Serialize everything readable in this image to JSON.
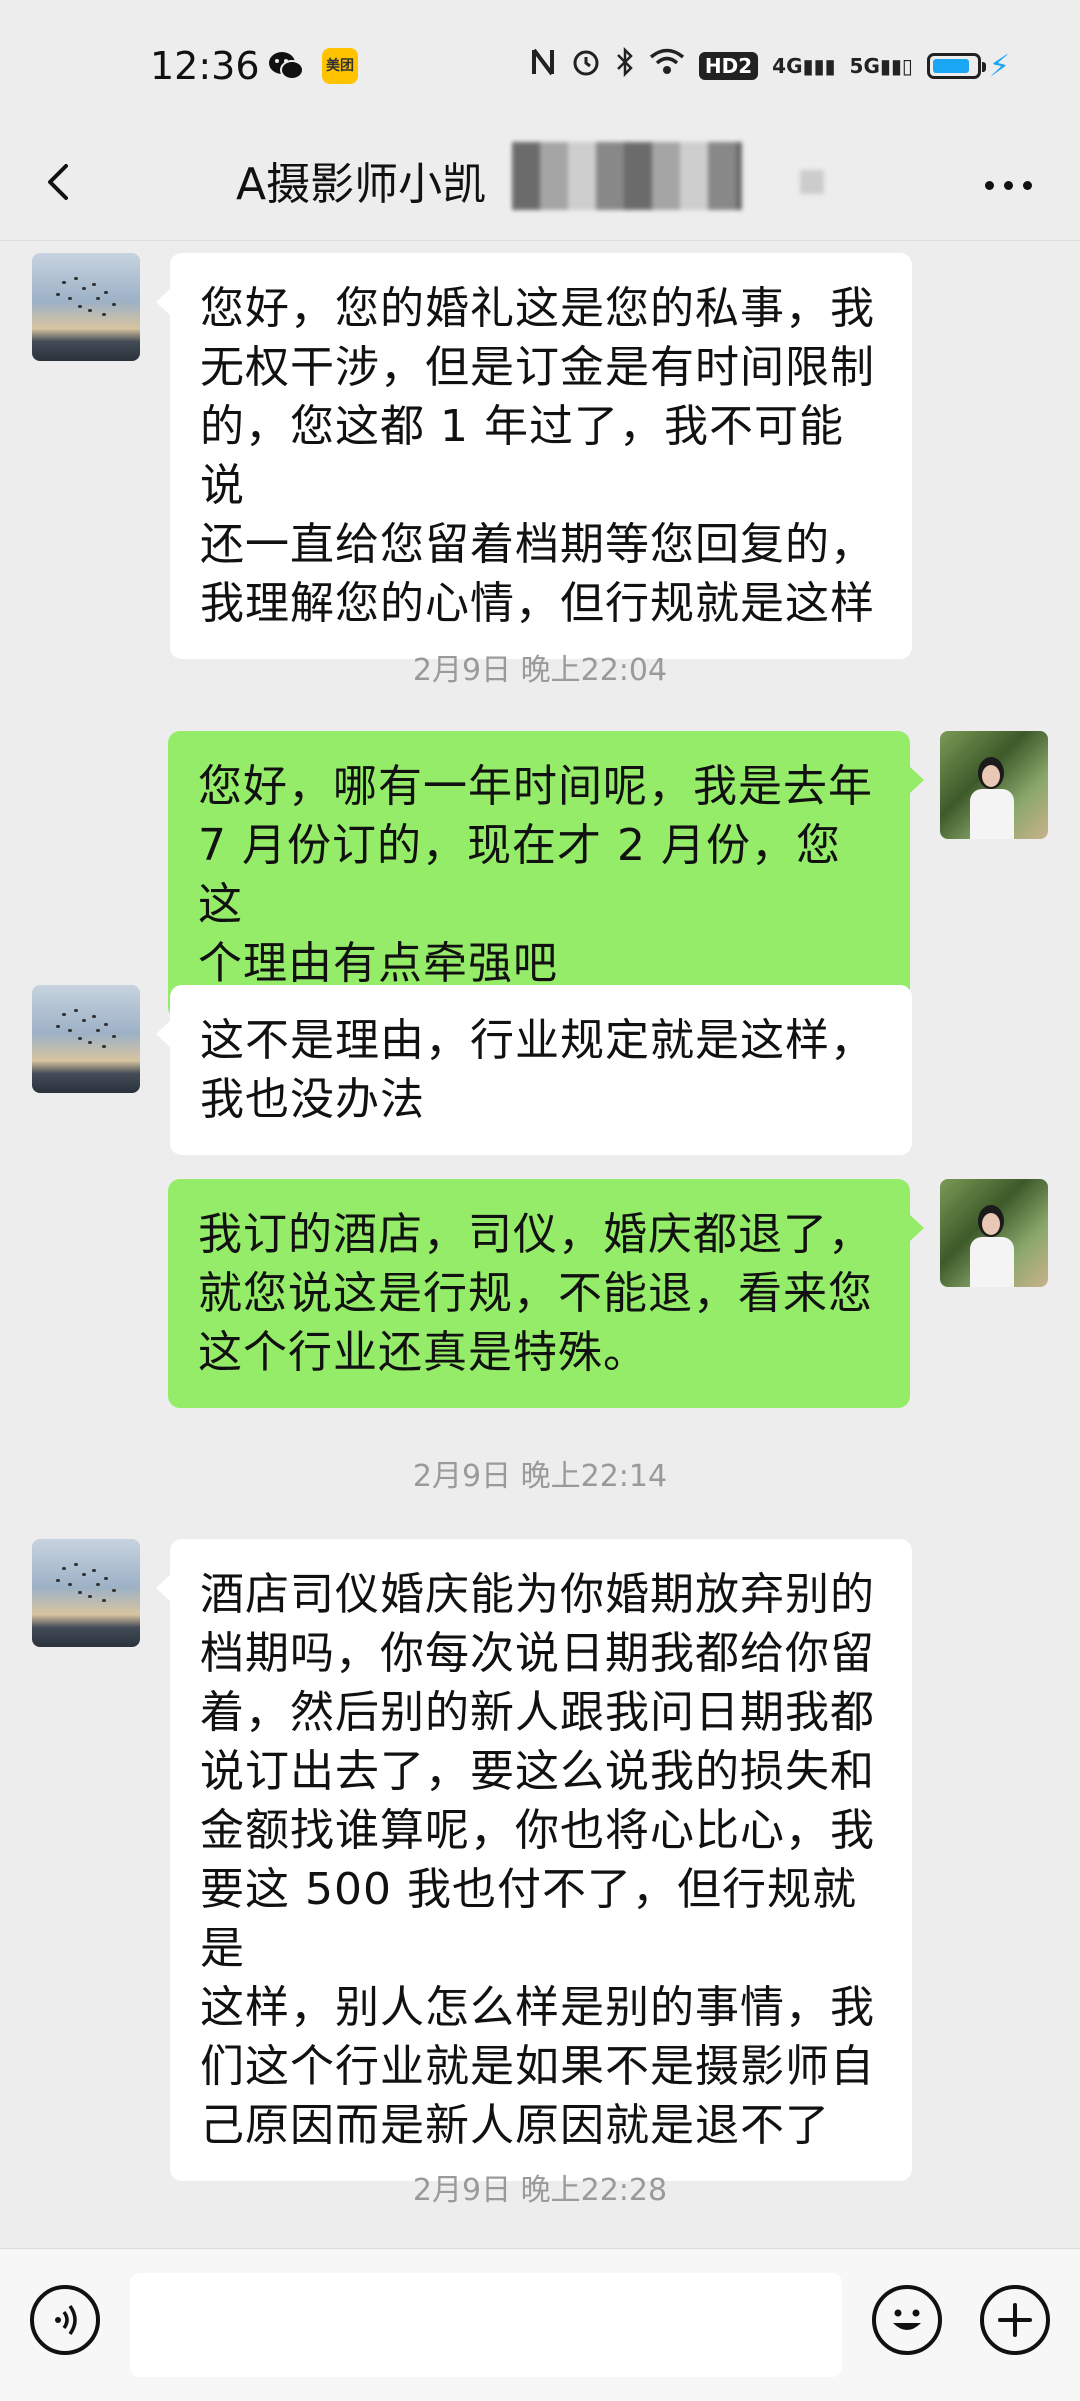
{
  "status_bar": {
    "time": "12:36",
    "icons": [
      "wechat-icon",
      "meituan-icon",
      "nfc-icon",
      "alarm-icon",
      "bluetooth-icon",
      "wifi-icon",
      "hd-icon",
      "signal-4g-icon",
      "signal-5g-icon",
      "battery-icon",
      "charging-icon"
    ],
    "meituan_label": "美团",
    "hd_label": "HD2",
    "net1": "4G",
    "net2": "5G",
    "battery_level": 0.85,
    "battery_color": "#1aa6f5"
  },
  "header": {
    "title": "A摄影师小凯",
    "back_icon": "chevron-left-icon",
    "more_icon": "more-dots-icon"
  },
  "messages": [
    {
      "side": "left",
      "text": "您好，您的婚礼这是您的私事，我\n无权干涉，但是订金是有时间限制\n的，您这都 1 年过了，我不可能说\n还一直给您留着档期等您回复的，\n我理解您的心情，但行规就是这样"
    },
    {
      "type": "time",
      "text": "2月9日 晚上22:04"
    },
    {
      "side": "right",
      "text": "您好，哪有一年时间呢，我是去年\n7 月份订的，现在才 2 月份，您这\n个理由有点牵强吧"
    },
    {
      "side": "left",
      "text": "这不是理由，行业规定就是这样，\n我也没办法"
    },
    {
      "side": "right",
      "text": "我订的酒店，司仪，婚庆都退了，\n就您说这是行规，不能退，看来您\n这个行业还真是特殊。"
    },
    {
      "type": "time",
      "text": "2月9日 晚上22:14"
    },
    {
      "side": "left",
      "text": "酒店司仪婚庆能为你婚期放弃别的\n档期吗，你每次说日期我都给你留\n着，然后别的新人跟我问日期我都\n说订出去了，要这么说我的损失和\n金额找谁算呢，你也将心比心，我\n要这 500 我也付不了，但行规就是\n这样，别人怎么样是别的事情，我\n们这个行业就是如果不是摄影师自\n己原因而是新人原因就是退不了"
    },
    {
      "type": "time",
      "text": "2月9日 晚上22:28"
    }
  ],
  "input_bar": {
    "voice_icon": "voice-icon",
    "emoji_icon": "emoji-icon",
    "plus_icon": "plus-icon",
    "input_value": ""
  },
  "colors": {
    "background": "#ededed",
    "bubble_self": "#95ec69",
    "bubble_other": "#ffffff",
    "timestamp": "#9a9a9a"
  }
}
